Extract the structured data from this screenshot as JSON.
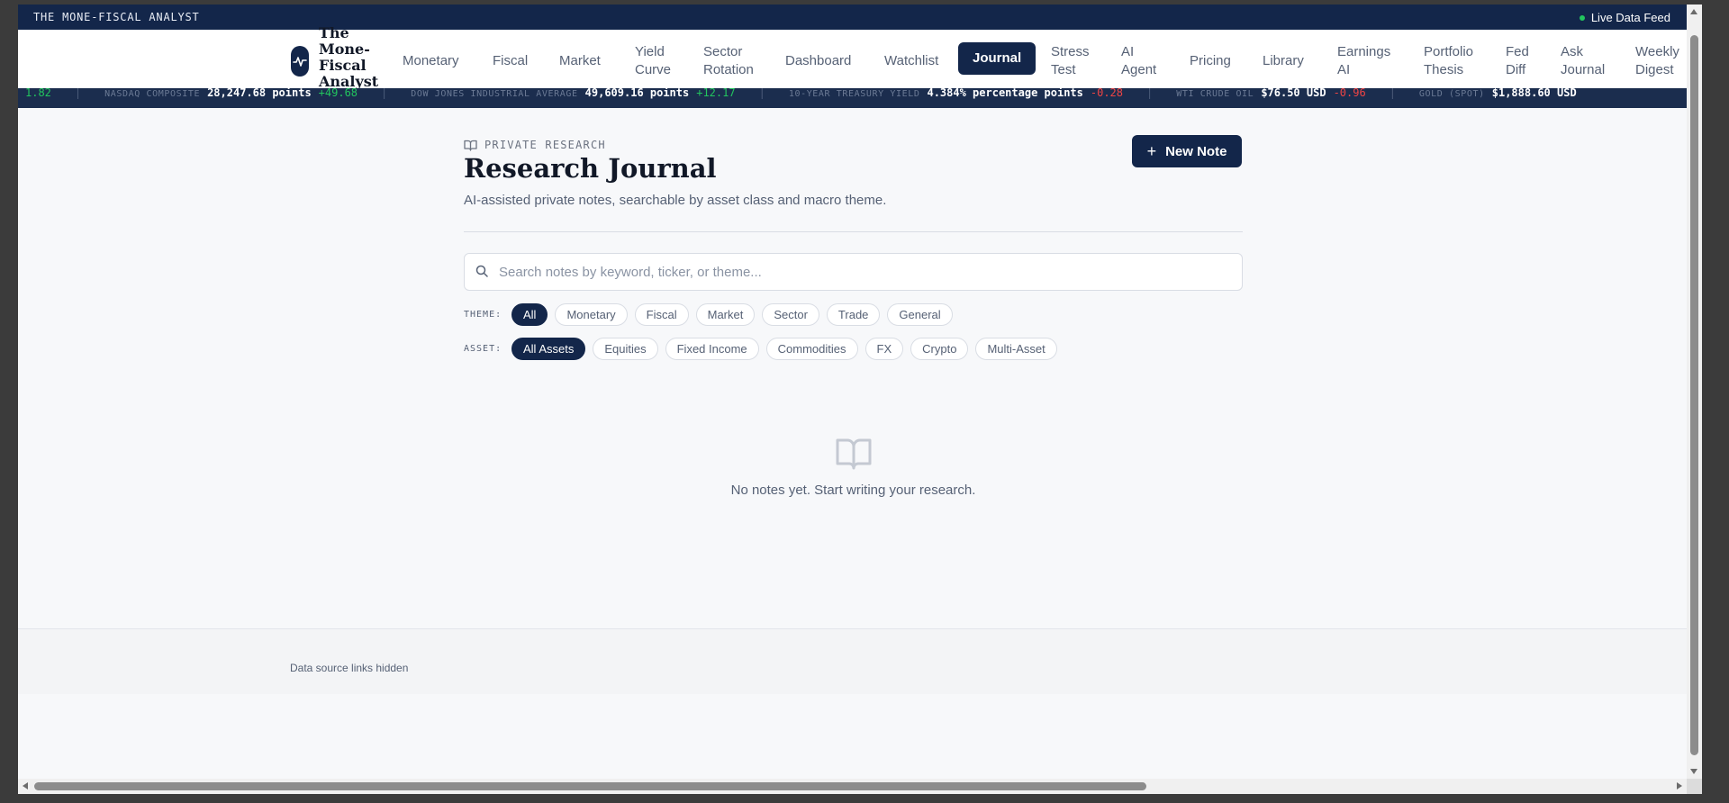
{
  "topbar": {
    "brand": "THE MONE-FISCAL ANALYST",
    "live_label": "Live Data Feed"
  },
  "logo": {
    "lines": [
      "The",
      "Mone-",
      "Fiscal",
      "Analyst"
    ]
  },
  "nav": {
    "items": [
      {
        "lines": [
          "Monetary"
        ]
      },
      {
        "lines": [
          "Fiscal"
        ]
      },
      {
        "lines": [
          "Market"
        ]
      },
      {
        "lines": [
          "Yield",
          "Curve"
        ]
      },
      {
        "lines": [
          "Sector",
          "Rotation"
        ]
      },
      {
        "lines": [
          "Dashboard"
        ]
      },
      {
        "lines": [
          "Watchlist"
        ]
      },
      {
        "lines": [
          "Journal"
        ],
        "active": true
      },
      {
        "lines": [
          "Stress",
          "Test"
        ]
      },
      {
        "lines": [
          "AI",
          "Agent"
        ]
      },
      {
        "lines": [
          "Pricing"
        ]
      },
      {
        "lines": [
          "Library"
        ]
      },
      {
        "lines": [
          "Earnings",
          "AI"
        ]
      },
      {
        "lines": [
          "Portfolio",
          "Thesis"
        ]
      },
      {
        "lines": [
          "Fed",
          "Diff"
        ]
      },
      {
        "lines": [
          "Ask",
          "Journal"
        ]
      },
      {
        "lines": [
          "Weekly",
          "Digest"
        ]
      }
    ]
  },
  "ticker": {
    "items": [
      {
        "label": "",
        "value": "",
        "change": "1.82",
        "dir": "up"
      },
      {
        "label": "NASDAQ COMPOSITE",
        "value": "28,247.68 points",
        "change": "+49.68",
        "dir": "up"
      },
      {
        "label": "DOW JONES INDUSTRIAL AVERAGE",
        "value": "49,609.16 points",
        "change": "+12.17",
        "dir": "up"
      },
      {
        "label": "10-YEAR TREASURY YIELD",
        "value": "4.384% percentage points",
        "change": "-0.28",
        "dir": "down"
      },
      {
        "label": "WTI CRUDE OIL",
        "value": "$76.50 USD",
        "change": "-0.96",
        "dir": "down"
      },
      {
        "label": "GOLD (SPOT)",
        "value": "$1,888.60 USD",
        "change": "",
        "dir": "up"
      }
    ]
  },
  "page": {
    "eyebrow": "PRIVATE RESEARCH",
    "title": "Research Journal",
    "subtitle": "AI-assisted private notes, searchable by asset class and macro theme.",
    "new_note_label": "New Note",
    "search_placeholder": "Search notes by keyword, ticker, or theme...",
    "search_value": "",
    "theme_label": "THEME:",
    "themes": [
      {
        "label": "All",
        "active": true
      },
      {
        "label": "Monetary"
      },
      {
        "label": "Fiscal"
      },
      {
        "label": "Market"
      },
      {
        "label": "Sector"
      },
      {
        "label": "Trade"
      },
      {
        "label": "General"
      }
    ],
    "asset_label": "ASSET:",
    "assets": [
      {
        "label": "All Assets",
        "active": true
      },
      {
        "label": "Equities"
      },
      {
        "label": "Fixed Income"
      },
      {
        "label": "Commodities"
      },
      {
        "label": "FX"
      },
      {
        "label": "Crypto"
      },
      {
        "label": "Multi-Asset"
      }
    ],
    "empty_message": "No notes yet. Start writing your research."
  },
  "footer": {
    "text": "Data source links hidden"
  },
  "colors": {
    "navy": "#13264a",
    "up": "#22c55e",
    "down": "#ef4444"
  },
  "icons": {
    "logo": "pulse-icon",
    "eyebrow": "book-open-icon",
    "new_note": "plus-icon",
    "search": "search-icon",
    "empty": "book-open-icon"
  }
}
